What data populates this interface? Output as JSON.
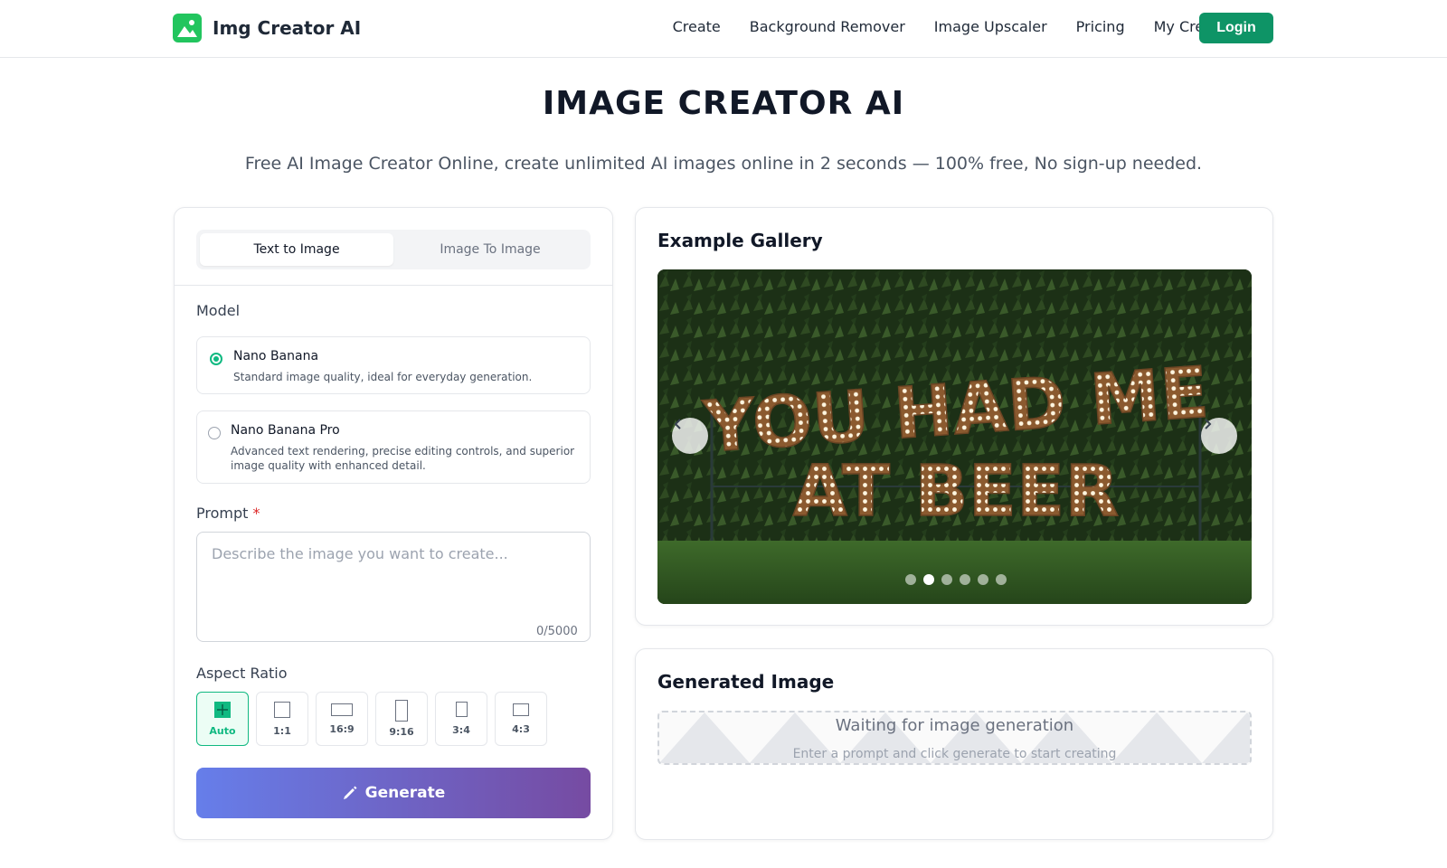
{
  "header": {
    "brand": "Img Creator AI",
    "nav": [
      "Create",
      "Background Remover",
      "Image Upscaler",
      "Pricing",
      "My Creations"
    ],
    "login_label": "Login"
  },
  "hero": {
    "title": "IMAGE CREATOR AI",
    "subtitle": "Free AI Image Creator Online, create unlimited AI images online in 2 seconds — 100% free, No sign-up needed."
  },
  "creator": {
    "tabs": [
      {
        "label": "Text to Image",
        "active": true
      },
      {
        "label": "Image To Image",
        "active": false
      }
    ],
    "model_label": "Model",
    "models": [
      {
        "name": "Nano Banana",
        "description": "Standard image quality, ideal for everyday generation.",
        "selected": true
      },
      {
        "name": "Nano Banana Pro",
        "description": "Advanced text rendering, precise editing controls, and superior image quality with enhanced detail.",
        "selected": false
      }
    ],
    "prompt_label": "Prompt",
    "prompt_required_mark": "*",
    "prompt_placeholder": "Describe the image you want to create...",
    "prompt_value": "",
    "char_count": "0/5000",
    "aspect_label": "Aspect Ratio",
    "aspect_ratios": [
      {
        "label": "Auto",
        "active": true
      },
      {
        "label": "1:1",
        "active": false
      },
      {
        "label": "16:9",
        "active": false
      },
      {
        "label": "9:16",
        "active": false
      },
      {
        "label": "3:4",
        "active": false
      },
      {
        "label": "4:3",
        "active": false
      }
    ],
    "generate_label": "Generate"
  },
  "gallery": {
    "title": "Example Gallery",
    "image_text_line1": "YOU HAD ME",
    "image_text_line2": "AT BEER",
    "slide_count": 6,
    "active_slide": 1
  },
  "generated": {
    "title": "Generated Image",
    "waiting_title": "Waiting for image generation",
    "waiting_sub": "Enter a prompt and click generate to start creating"
  },
  "colors": {
    "accent": "#0e9466",
    "selected": "#10b981",
    "generate_gradient_start": "#667eea",
    "generate_gradient_end": "#764ba2"
  }
}
